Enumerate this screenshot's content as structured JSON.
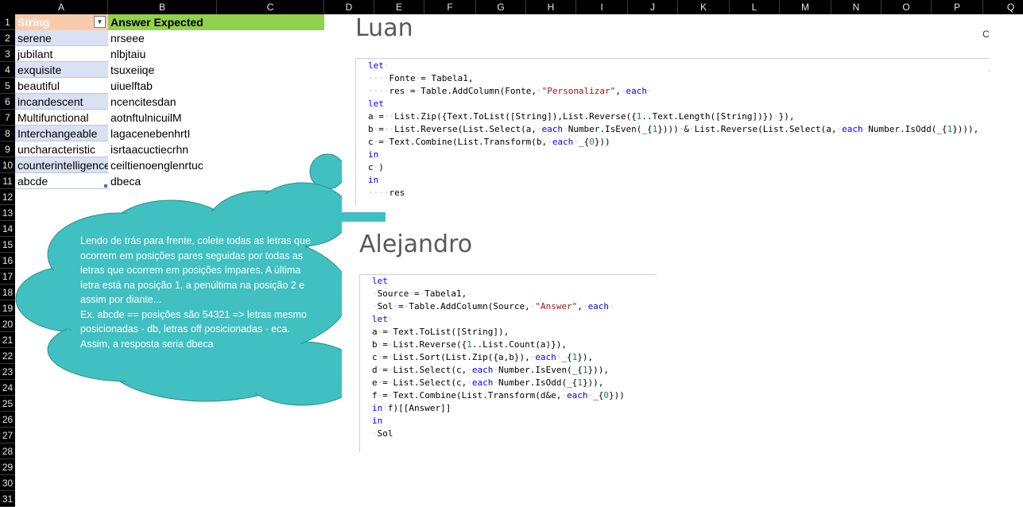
{
  "columns": [
    "A",
    "B",
    "C",
    "D",
    "E",
    "F",
    "G",
    "H",
    "I",
    "J",
    "K",
    "L",
    "M",
    "N",
    "O",
    "P",
    "Q"
  ],
  "rows": [
    "1",
    "2",
    "3",
    "4",
    "5",
    "6",
    "7",
    "8",
    "9",
    "10",
    "11",
    "12",
    "13",
    "14",
    "15",
    "16",
    "17",
    "18",
    "19",
    "20",
    "21",
    "22",
    "23",
    "24",
    "25",
    "26",
    "27",
    "28",
    "29",
    "30",
    "31"
  ],
  "table": {
    "header_string": "String",
    "header_answer": "Answer Expected",
    "strings": [
      "serene",
      "jubilant",
      "exquisite",
      "beautiful",
      "incandescent",
      "Multifunctional",
      "Interchangeable",
      "uncharacteristic",
      "counterintelligence",
      "abcde"
    ],
    "answers": [
      "nrseee",
      "nlbjtaiu",
      "tsuxeiiqe",
      "uiuelftab",
      "ncencitesdan",
      "aotnftulnicuilM",
      "lagacenebenhrtI",
      "isrtaacuctiecrhn",
      "ceiltienoenglenrtuc",
      "dbeca"
    ]
  },
  "cloud_note": {
    "lines": [
      "Lendo de trás para frente, colete todas as letras que",
      "ocorrem em posições pares seguidas por todas as",
      "letras que ocorrem em posições ímpares. A última",
      "letra está na posição 1, a penúltima na posição 2 e",
      "assim por diante...",
      "Ex. abcde == posições são 54321 => letras mesmo",
      "posicionadas - db, letras off posicionadas - eca.",
      "Assim, a resposta seria dbeca"
    ],
    "fill_color": "#40c0c0"
  },
  "panel_luan": {
    "title": "Luan",
    "stray_char": "C"
  },
  "panel_alejandro": {
    "title": "Alejandro"
  }
}
